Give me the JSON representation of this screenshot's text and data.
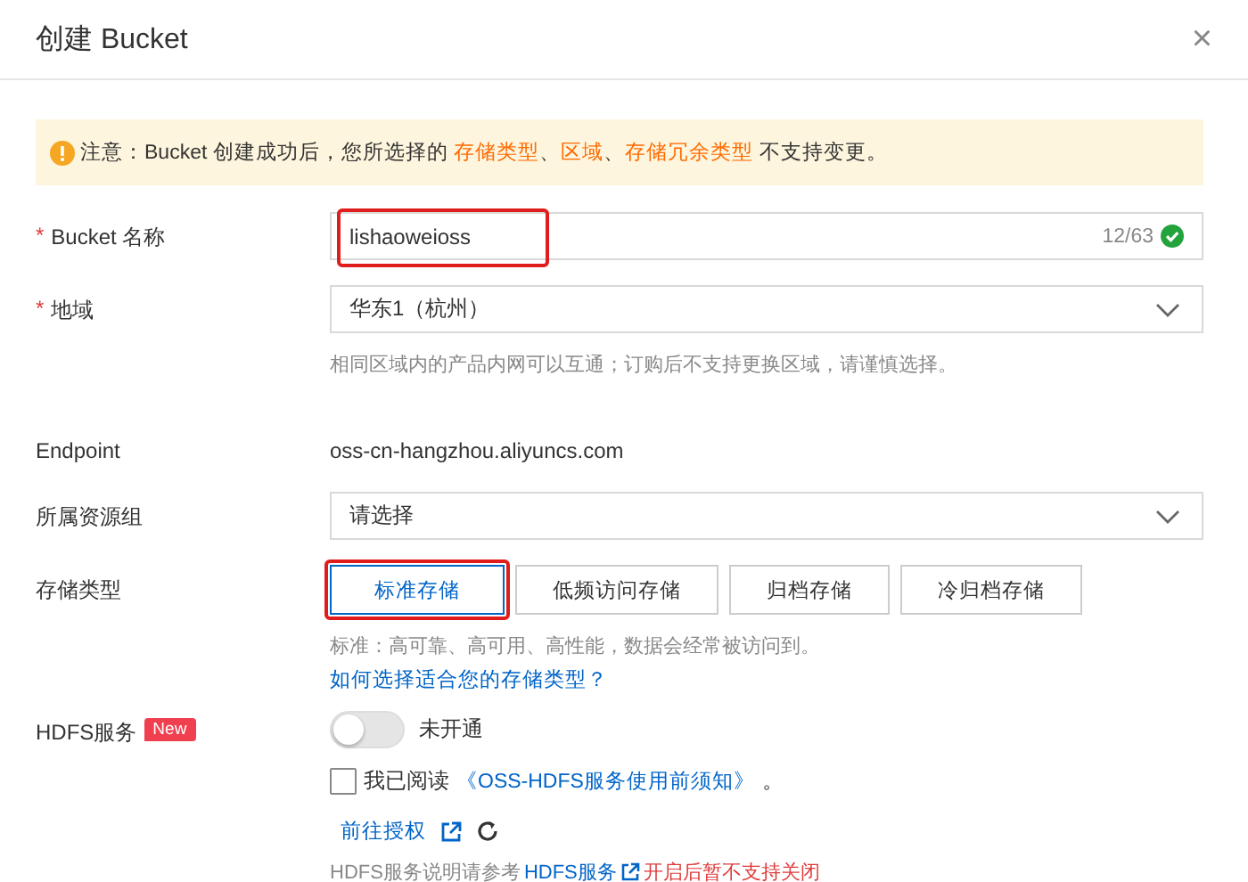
{
  "dialog": {
    "title": "创建 Bucket",
    "close": "×"
  },
  "notice": {
    "text": "注意：Bucket 创建成功后，您所选择的 **存储类型**、**区域**、**存储冗余类型** 不支持变更。"
  },
  "bucket_name": {
    "required_mark": "*",
    "label": "Bucket 名称",
    "value": "lishaoweioss",
    "counter": "12/63",
    "valid": true,
    "highlighted": true
  },
  "region": {
    "required_mark": "*",
    "label": "地域",
    "value": "华东1（杭州）",
    "hint": "相同区域内的产品内网可以互通；订购后不支持更换区域，请谨慎选择。"
  },
  "endpoint": {
    "label": "Endpoint",
    "value": "oss-cn-hangzhou.aliyuncs.com"
  },
  "resource_group": {
    "label": "所属资源组",
    "placeholder": "请选择"
  },
  "storage_class": {
    "label": "存储类型",
    "options": [
      {
        "label": "标准存储",
        "selected": true,
        "highlighted": true
      },
      {
        "label": "低频访问存储",
        "selected": false,
        "highlighted": false
      },
      {
        "label": "归档存储",
        "selected": false,
        "highlighted": false
      },
      {
        "label": "冷归档存储",
        "selected": false,
        "highlighted": false
      }
    ],
    "hint": "标准：高可靠、高可用、高性能，数据会经常被访问到。",
    "link": "如何选择适合您的存储类型？"
  },
  "hdfs": {
    "label": "HDFS服务",
    "badge": "New",
    "switch_on": false,
    "switch_text": "未开通",
    "agree_checked": false,
    "agree_text": "我已阅读",
    "agree_link": "《OSS-HDFS服务使用前须知》",
    "agree_end": "。",
    "authorize_link": "前往授权",
    "note_text": "HDFS服务说明请参考",
    "note_link": "HDFS服务",
    "note_warning": "开启后暂不支持关闭"
  }
}
